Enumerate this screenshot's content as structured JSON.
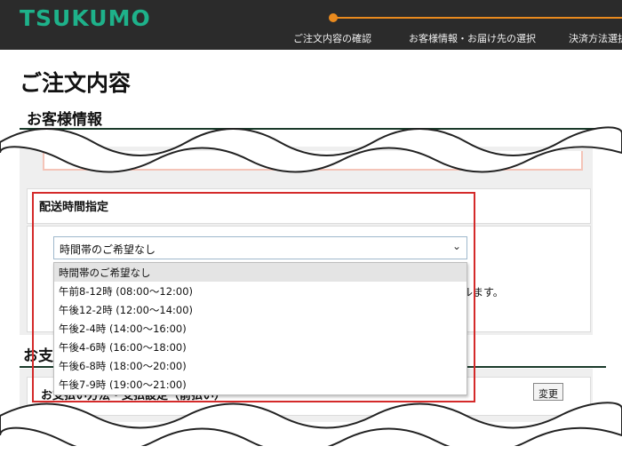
{
  "header": {
    "logo": "TSUKUMO",
    "steps": [
      "ご注文内容の確認",
      "お客様情報・お届け先の選択",
      "決済方法選択"
    ],
    "accent_color": "#e98a1e",
    "brand_color": "#1eb18a"
  },
  "page": {
    "title": "ご注文内容"
  },
  "customer_section": {
    "heading": "お客様情報"
  },
  "delivery": {
    "label": "配送時間指定",
    "selected": "時間帯のご希望なし",
    "options": [
      "時間帯のご希望なし",
      "午前8-12時 (08:00～12:00)",
      "午後12-2時 (12:00～14:00)",
      "午後2-4時 (14:00～16:00)",
      "午後4-6時 (16:00～18:00)",
      "午後6-8時 (18:00～20:00)",
      "午後7-9時 (19:00～21:00)"
    ],
    "note": "ルます。",
    "highlight_color": "#d42a2a"
  },
  "payment_section": {
    "heading_prefix": "お支",
    "label": "お支払い方法・支払設定（前払い）",
    "change_button": "変更"
  }
}
